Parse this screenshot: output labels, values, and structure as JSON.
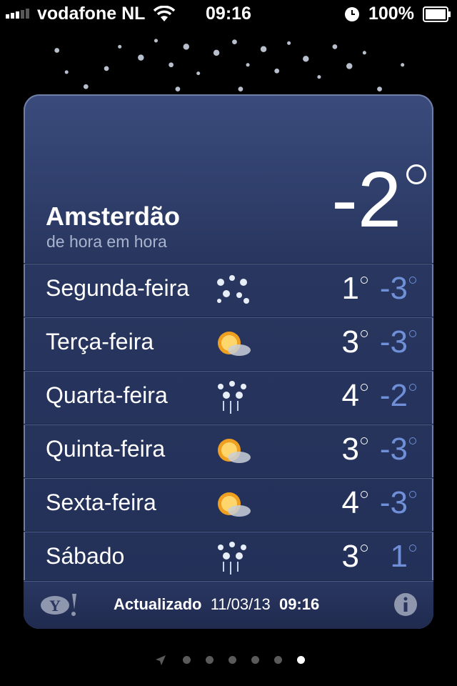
{
  "status_bar": {
    "carrier": "vodafone NL",
    "time": "09:16",
    "battery": "100%"
  },
  "weather": {
    "city": "Amsterdão",
    "subtitle": "de hora em hora",
    "current_temp": "-2",
    "forecast": [
      {
        "day": "Segunda-feira",
        "icon": "snow-icon",
        "high": "1",
        "low": "-3"
      },
      {
        "day": "Terça-feira",
        "icon": "sun-cloud-icon",
        "high": "3",
        "low": "-3"
      },
      {
        "day": "Quarta-feira",
        "icon": "snow-icon",
        "high": "4",
        "low": "-2"
      },
      {
        "day": "Quinta-feira",
        "icon": "sun-cloud-icon",
        "high": "3",
        "low": "-3"
      },
      {
        "day": "Sexta-feira",
        "icon": "sun-cloud-icon",
        "high": "4",
        "low": "-3"
      },
      {
        "day": "Sábado",
        "icon": "snow-icon",
        "high": "3",
        "low": "1"
      }
    ]
  },
  "footer": {
    "updated_label": "Actualizado",
    "updated_date": "11/03/13",
    "updated_time": "09:16"
  },
  "pager": {
    "pages": 6,
    "active_index": 5
  },
  "colors": {
    "low_temp": "#6f8fd8",
    "card_bg": "#293760"
  }
}
